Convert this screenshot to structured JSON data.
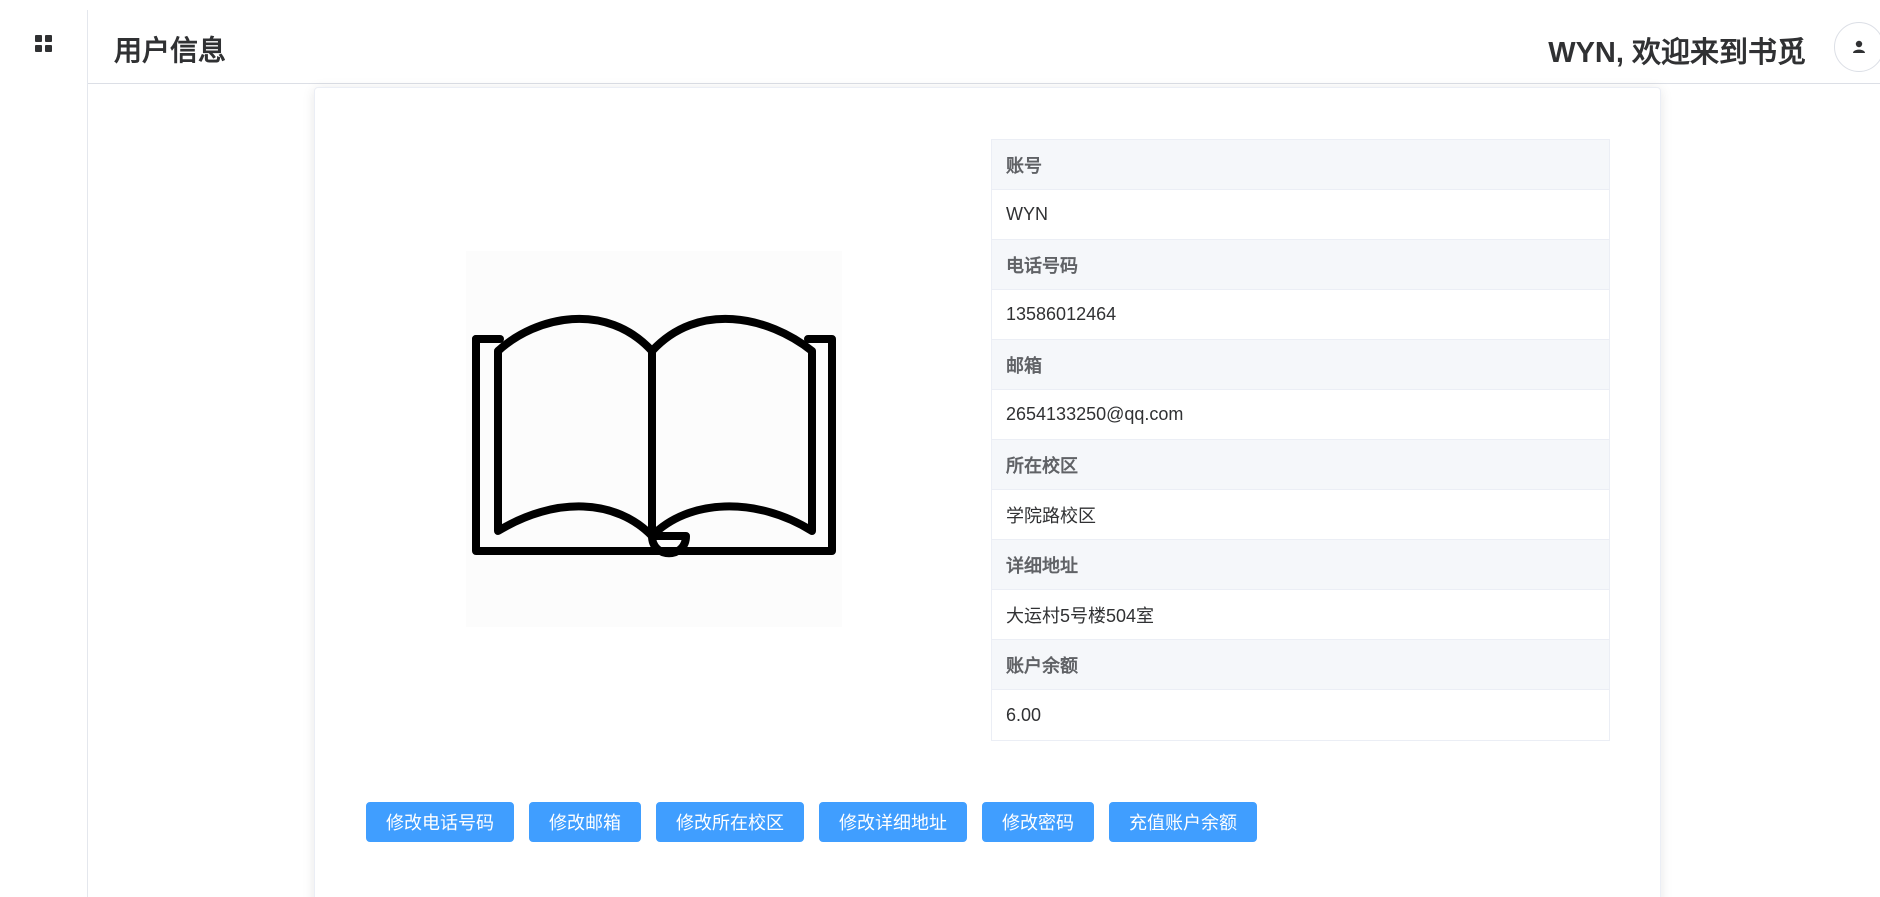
{
  "header": {
    "title": "用户信息",
    "welcome": "WYN, 欢迎来到书觅"
  },
  "icons": {
    "menu": "grid-icon",
    "avatar": "user-icon",
    "book": "open-book-icon"
  },
  "profile": {
    "fields": [
      {
        "label": "账号",
        "value": "WYN"
      },
      {
        "label": "电话号码",
        "value": "13586012464"
      },
      {
        "label": "邮箱",
        "value": "2654133250@qq.com"
      },
      {
        "label": "所在校区",
        "value": "学院路校区"
      },
      {
        "label": "详细地址",
        "value": "大运村5号楼504室"
      },
      {
        "label": "账户余额",
        "value": "6.00"
      }
    ]
  },
  "actions": [
    "修改电话号码",
    "修改邮箱",
    "修改所在校区",
    "修改详细地址",
    "修改密码",
    "充值账户余额"
  ],
  "colors": {
    "primary": "#409eff",
    "label_bg": "#f5f7fa",
    "border": "#ebeef5"
  }
}
